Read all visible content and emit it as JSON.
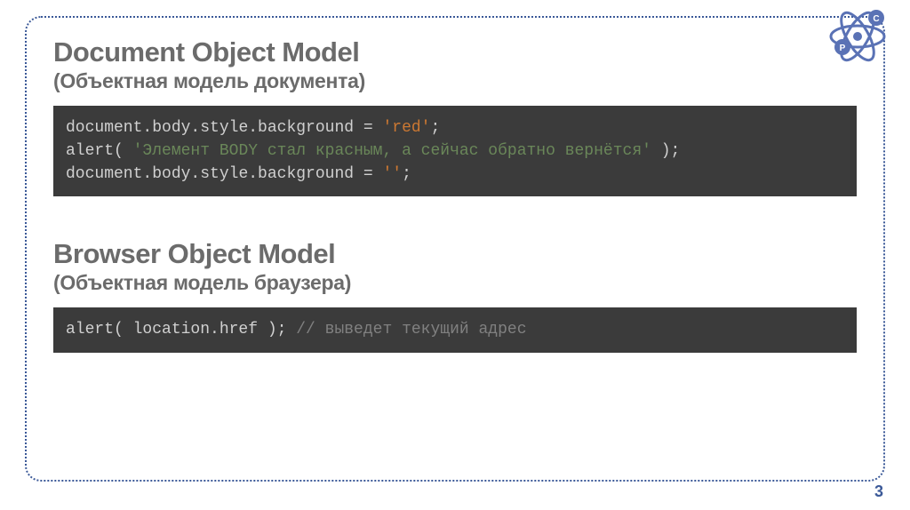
{
  "logo": {
    "letters": {
      "p": "P",
      "c": "С"
    }
  },
  "section1": {
    "title": "Document Object Model",
    "subtitle": "(Объектная модель документа)",
    "code": {
      "line1": {
        "a": "document",
        "b": ".body.style.background = ",
        "c": "'red'",
        "d": ";"
      },
      "line2": {
        "a": "alert( ",
        "b": "'Элемент BODY стал красным, а сейчас обратно вернётся'",
        "c": " );"
      },
      "line3": {
        "a": "document",
        "b": ".body.style.background = ",
        "c": "''",
        "d": ";"
      }
    }
  },
  "section2": {
    "title": "Browser Object Model",
    "subtitle": "(Объектная модель браузера)",
    "code": {
      "line1": {
        "a": "alert( location.href ); ",
        "b": "// выведет текущий адрес"
      }
    }
  },
  "page_number": "3"
}
